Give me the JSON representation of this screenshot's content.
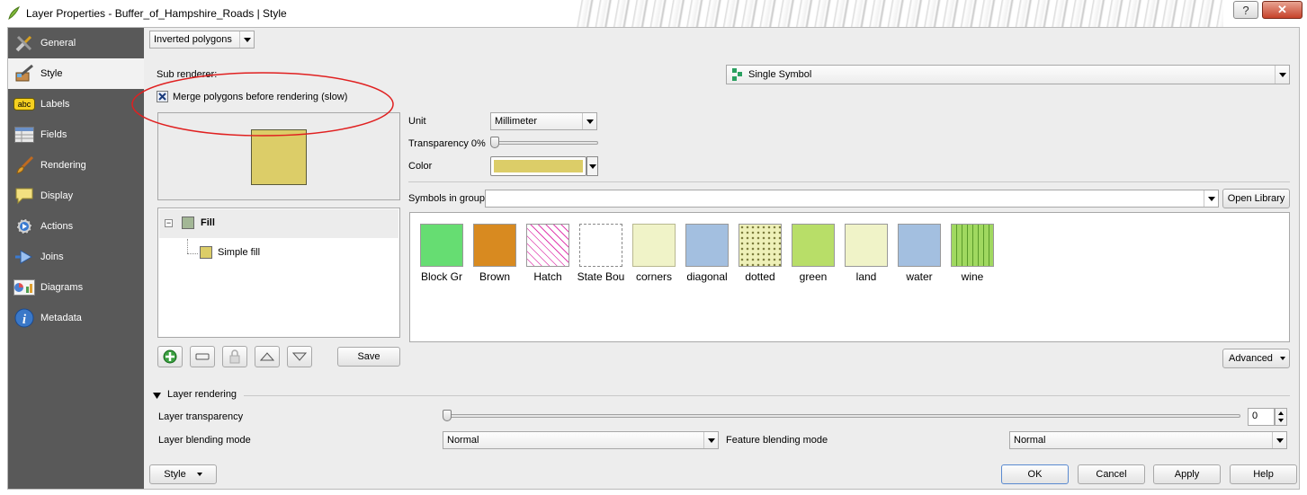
{
  "window": {
    "title": "Layer Properties - Buffer_of_Hampshire_Roads | Style",
    "help_label": "?",
    "close_label": "✕"
  },
  "sidebar": {
    "items": [
      {
        "label": "General",
        "icon": "general-icon"
      },
      {
        "label": "Style",
        "icon": "style-icon"
      },
      {
        "label": "Labels",
        "icon": "labels-icon"
      },
      {
        "label": "Fields",
        "icon": "fields-icon"
      },
      {
        "label": "Rendering",
        "icon": "rendering-icon"
      },
      {
        "label": "Display",
        "icon": "display-icon"
      },
      {
        "label": "Actions",
        "icon": "actions-icon"
      },
      {
        "label": "Joins",
        "icon": "joins-icon"
      },
      {
        "label": "Diagrams",
        "icon": "diagrams-icon"
      },
      {
        "label": "Metadata",
        "icon": "metadata-icon"
      }
    ],
    "active": "Style"
  },
  "style": {
    "renderer_type": "Inverted polygons",
    "sub_renderer_label": "Sub renderer:",
    "sub_renderer_value": "Single Symbol",
    "merge_checkbox_label": "Merge polygons before rendering (slow)",
    "merge_checked": true,
    "preview_color": "#dccd68",
    "tree": {
      "root_label": "Fill",
      "child_label": "Simple fill",
      "root_swatch": "#a3b796",
      "child_swatch": "#dccd68"
    },
    "unit_label": "Unit",
    "unit_value": "Millimeter",
    "transparency_label": "Transparency 0%",
    "transparency_value": 0,
    "color_label": "Color",
    "color_value": "#dccd68",
    "symbols_in_group_label": "Symbols in group",
    "symbols_in_group_value": "",
    "open_library_label": "Open Library",
    "symbols": [
      {
        "name": "Block Gr",
        "color": "#66dd72",
        "pattern": "solid"
      },
      {
        "name": "Brown",
        "color": "#d88a20",
        "pattern": "solid"
      },
      {
        "name": "Hatch",
        "color": "#e040b0",
        "pattern": "hatch"
      },
      {
        "name": "State Bou",
        "color": "#ffffff",
        "pattern": "dashed"
      },
      {
        "name": "corners",
        "color": "#f0f3c8",
        "pattern": "corners"
      },
      {
        "name": "diagonal",
        "color": "#a3bfe0",
        "pattern": "solid"
      },
      {
        "name": "dotted",
        "color": "#eef0b8",
        "pattern": "dotted"
      },
      {
        "name": "green",
        "color": "#b8de68",
        "pattern": "solid"
      },
      {
        "name": "land",
        "color": "#f0f3c8",
        "pattern": "solid"
      },
      {
        "name": "water",
        "color": "#a3bfe0",
        "pattern": "solid"
      },
      {
        "name": "wine",
        "color": "#a0d860",
        "pattern": "wine"
      }
    ],
    "advanced_label": "Advanced",
    "save_label": "Save"
  },
  "layer_rendering": {
    "section_label": "Layer rendering",
    "transparency_label": "Layer transparency",
    "transparency_value": "0",
    "layer_blend_label": "Layer blending mode",
    "layer_blend_value": "Normal",
    "feature_blend_label": "Feature blending mode",
    "feature_blend_value": "Normal"
  },
  "footer": {
    "style_menu_label": "Style",
    "ok_label": "OK",
    "cancel_label": "Cancel",
    "apply_label": "Apply",
    "help_label": "Help"
  },
  "annotation": {
    "color": "#e02020"
  }
}
